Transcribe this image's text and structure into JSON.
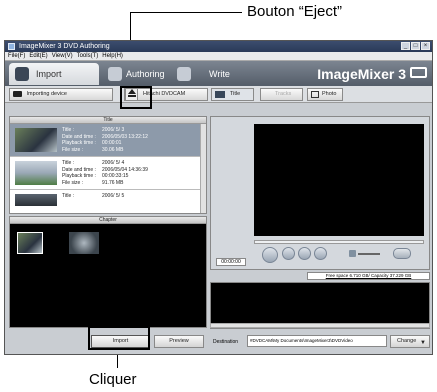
{
  "annotations": {
    "eject_callout": "Bouton “Eject”",
    "click_callout": "Cliquer"
  },
  "window": {
    "title": "ImageMixer 3 DVD Authoring",
    "controls": [
      "minimize-icon",
      "maximize-icon",
      "close-icon"
    ]
  },
  "menu": [
    "File(F)",
    "Edit(E)",
    "View(V)",
    "Tools(T)",
    "Help(H)"
  ],
  "tabs": [
    {
      "label": "Import",
      "active": true,
      "icon": "import-icon"
    },
    {
      "label": "Authoring",
      "active": false,
      "icon": "authoring-icon"
    },
    {
      "label": "Write",
      "active": false,
      "icon": "write-icon"
    }
  ],
  "brand": "ImageMixer 3",
  "toolbar": {
    "importing_device": "Importing device",
    "source": "Hitachi DVDCAM",
    "eject_icon": "eject-icon",
    "view_title": "Title",
    "view_tracks": "Tracks",
    "view_photo": "Photo"
  },
  "title_panel": {
    "header": "Title",
    "items": [
      {
        "title": "2006/ 5/ 3",
        "date_time": "2006/05/03 13:22:12",
        "playback_time": "00:00:01",
        "file_size": "30.06 MB",
        "selected": true
      },
      {
        "title": "2006/ 5/ 4",
        "date_time": "2006/05/04 14:36:39",
        "playback_time": "00:00:33:15",
        "file_size": "91.76 MB",
        "selected": false
      },
      {
        "title": "2006/ 5/ 5",
        "date_time": "",
        "playback_time": "",
        "file_size": "",
        "selected": false
      }
    ],
    "labels": {
      "title": "Title :",
      "date_time": "Date and time :",
      "playback_time": "Playback time :",
      "file_size": "File size :"
    }
  },
  "chapter_panel": {
    "header": "Chapter"
  },
  "buttons": {
    "import": "Import",
    "preview": "Preview",
    "change": "Change"
  },
  "player": {
    "time": "00:00:00"
  },
  "disk_info": "Free space 6.710 GB/ Capacity 37.229 GB",
  "destination": {
    "label": "Destination",
    "path": "#DVDCAM\\My Documents\\ImageMixer3\\DVDVideo"
  }
}
